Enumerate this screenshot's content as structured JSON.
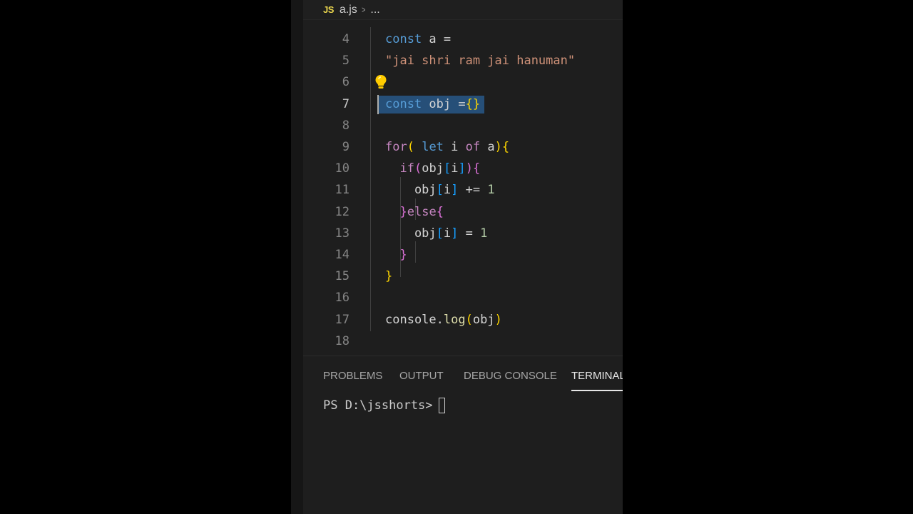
{
  "breadcrumb": {
    "icon": "JS",
    "file": "a.js",
    "separator": ">",
    "ellipsis": "..."
  },
  "editor": {
    "lines": [
      {
        "no": "4",
        "tokens": [
          {
            "t": "const",
            "c": "kw"
          },
          {
            "t": " a ",
            "c": "plain"
          },
          {
            "t": "=",
            "c": "plain"
          }
        ]
      },
      {
        "no": "5",
        "tokens": [
          {
            "t": "\"jai shri ram jai hanuman\"",
            "c": "str"
          }
        ]
      },
      {
        "no": "6",
        "tokens": []
      },
      {
        "no": "7",
        "tokens": [
          {
            "t": "const",
            "c": "kw"
          },
          {
            "t": " obj ",
            "c": "ident"
          },
          {
            "t": "=",
            "c": "plain"
          },
          {
            "t": "{}",
            "c": "b1"
          }
        ]
      },
      {
        "no": "8",
        "tokens": []
      },
      {
        "no": "9",
        "tokens": [
          {
            "t": "for",
            "c": "kw2"
          },
          {
            "t": "(",
            "c": "b1"
          },
          {
            "t": " let",
            "c": "kw"
          },
          {
            "t": " i ",
            "c": "ident"
          },
          {
            "t": "of",
            "c": "kw2"
          },
          {
            "t": " a",
            "c": "ident"
          },
          {
            "t": ")",
            "c": "b1"
          },
          {
            "t": "{",
            "c": "b1"
          }
        ]
      },
      {
        "no": "10",
        "tokens": [
          {
            "t": "  ",
            "c": "plain"
          },
          {
            "t": "if",
            "c": "kw2"
          },
          {
            "t": "(",
            "c": "b2"
          },
          {
            "t": "obj",
            "c": "ident"
          },
          {
            "t": "[",
            "c": "b3"
          },
          {
            "t": "i",
            "c": "ident"
          },
          {
            "t": "]",
            "c": "b3"
          },
          {
            "t": ")",
            "c": "b2"
          },
          {
            "t": "{",
            "c": "b2"
          }
        ]
      },
      {
        "no": "11",
        "tokens": [
          {
            "t": "    obj",
            "c": "ident"
          },
          {
            "t": "[",
            "c": "b3"
          },
          {
            "t": "i",
            "c": "ident"
          },
          {
            "t": "]",
            "c": "b3"
          },
          {
            "t": " += ",
            "c": "plain"
          },
          {
            "t": "1",
            "c": "num"
          }
        ]
      },
      {
        "no": "12",
        "tokens": [
          {
            "t": "  ",
            "c": "plain"
          },
          {
            "t": "}",
            "c": "b2"
          },
          {
            "t": "else",
            "c": "kw2"
          },
          {
            "t": "{",
            "c": "b2"
          }
        ]
      },
      {
        "no": "13",
        "tokens": [
          {
            "t": "    obj",
            "c": "ident"
          },
          {
            "t": "[",
            "c": "b3"
          },
          {
            "t": "i",
            "c": "ident"
          },
          {
            "t": "]",
            "c": "b3"
          },
          {
            "t": " = ",
            "c": "plain"
          },
          {
            "t": "1",
            "c": "num"
          }
        ]
      },
      {
        "no": "14",
        "tokens": [
          {
            "t": "  ",
            "c": "plain"
          },
          {
            "t": "}",
            "c": "b2"
          }
        ]
      },
      {
        "no": "15",
        "tokens": [
          {
            "t": "}",
            "c": "b1"
          }
        ]
      },
      {
        "no": "16",
        "tokens": []
      },
      {
        "no": "17",
        "tokens": [
          {
            "t": "console",
            "c": "ident"
          },
          {
            "t": ".",
            "c": "plain"
          },
          {
            "t": "log",
            "c": "fn"
          },
          {
            "t": "(",
            "c": "b1"
          },
          {
            "t": "obj",
            "c": "ident"
          },
          {
            "t": ")",
            "c": "b1"
          }
        ]
      },
      {
        "no": "18",
        "tokens": []
      }
    ],
    "active_line": "7",
    "lightbulb_line": "6",
    "colors": {
      "keyword": "#569cd6",
      "control": "#c586c0",
      "string": "#ce9178",
      "number": "#b5cea8",
      "function": "#dcdcaa",
      "selection": "#264f78"
    }
  },
  "panel": {
    "tabs": [
      {
        "label": "PROBLEMS",
        "active": false
      },
      {
        "label": "OUTPUT",
        "active": false
      },
      {
        "label": "DEBUG CONSOLE",
        "active": false
      },
      {
        "label": "TERMINAL",
        "active": true
      }
    ],
    "terminal_prompt": "PS D:\\jsshorts>"
  }
}
